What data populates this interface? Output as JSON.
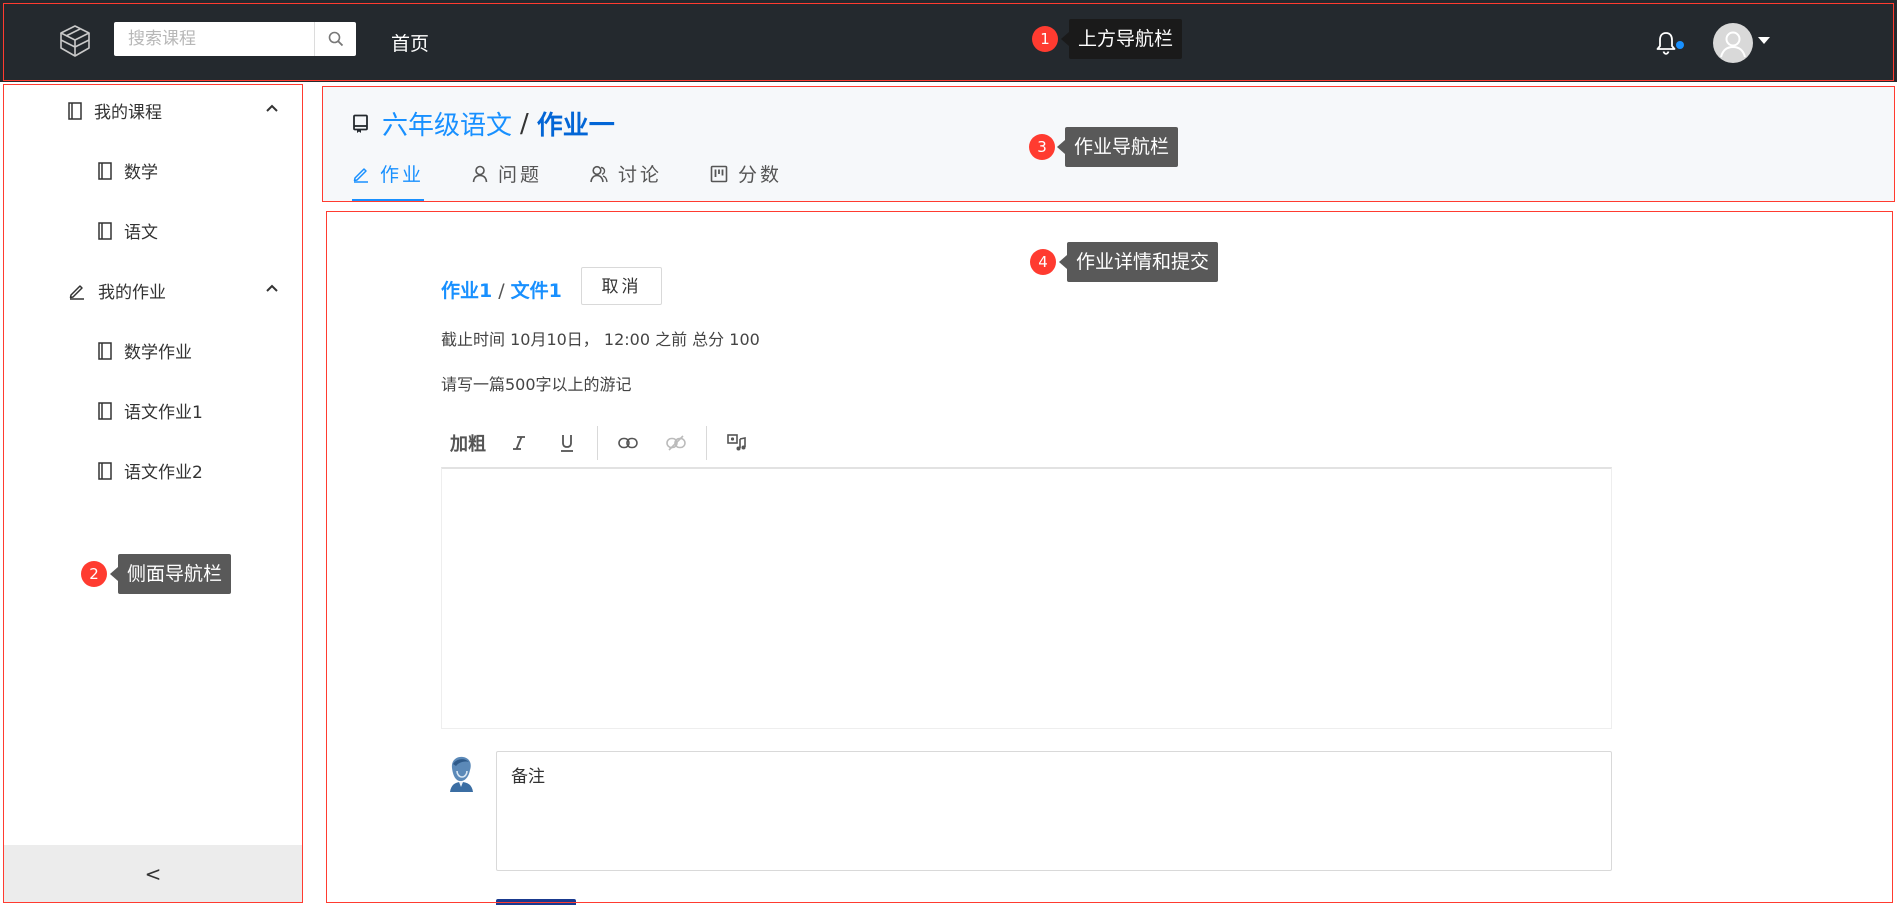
{
  "topbar": {
    "search_placeholder": "搜索课程",
    "home_label": "首页"
  },
  "sidebar": {
    "groups": [
      {
        "label": "我的课程",
        "items": [
          "数学",
          "语文"
        ]
      },
      {
        "label": "我的作业",
        "items": [
          "数学作业",
          "语文作业1",
          "语文作业2"
        ]
      }
    ],
    "collapse_symbol": "<"
  },
  "header": {
    "course": "六年级语文",
    "separator": "/",
    "homework": "作业一",
    "tabs": [
      "作业",
      "问题",
      "讨论",
      "分数"
    ],
    "active_tab": "作业"
  },
  "assignment": {
    "title_part1": "作业1",
    "title_sep": "/",
    "title_part2": "文件1",
    "cancel_label": "取消",
    "deadline": "截止时间 10月10日， 12:00 之前 总分 100",
    "prompt": "请写一篇500字以上的游记",
    "toolbar": {
      "bold_label": "加粗"
    },
    "remark_placeholder": "备注"
  },
  "annotations": [
    {
      "num": "1",
      "label": "上方导航栏"
    },
    {
      "num": "2",
      "label": "侧面导航栏"
    },
    {
      "num": "3",
      "label": "作业导航栏"
    },
    {
      "num": "4",
      "label": "作业详情和提交"
    }
  ],
  "colors": {
    "topbar_bg": "#24292e",
    "accent": "#1890ff",
    "annotation_red": "#ff3b30",
    "annotation_label": "#595959"
  }
}
